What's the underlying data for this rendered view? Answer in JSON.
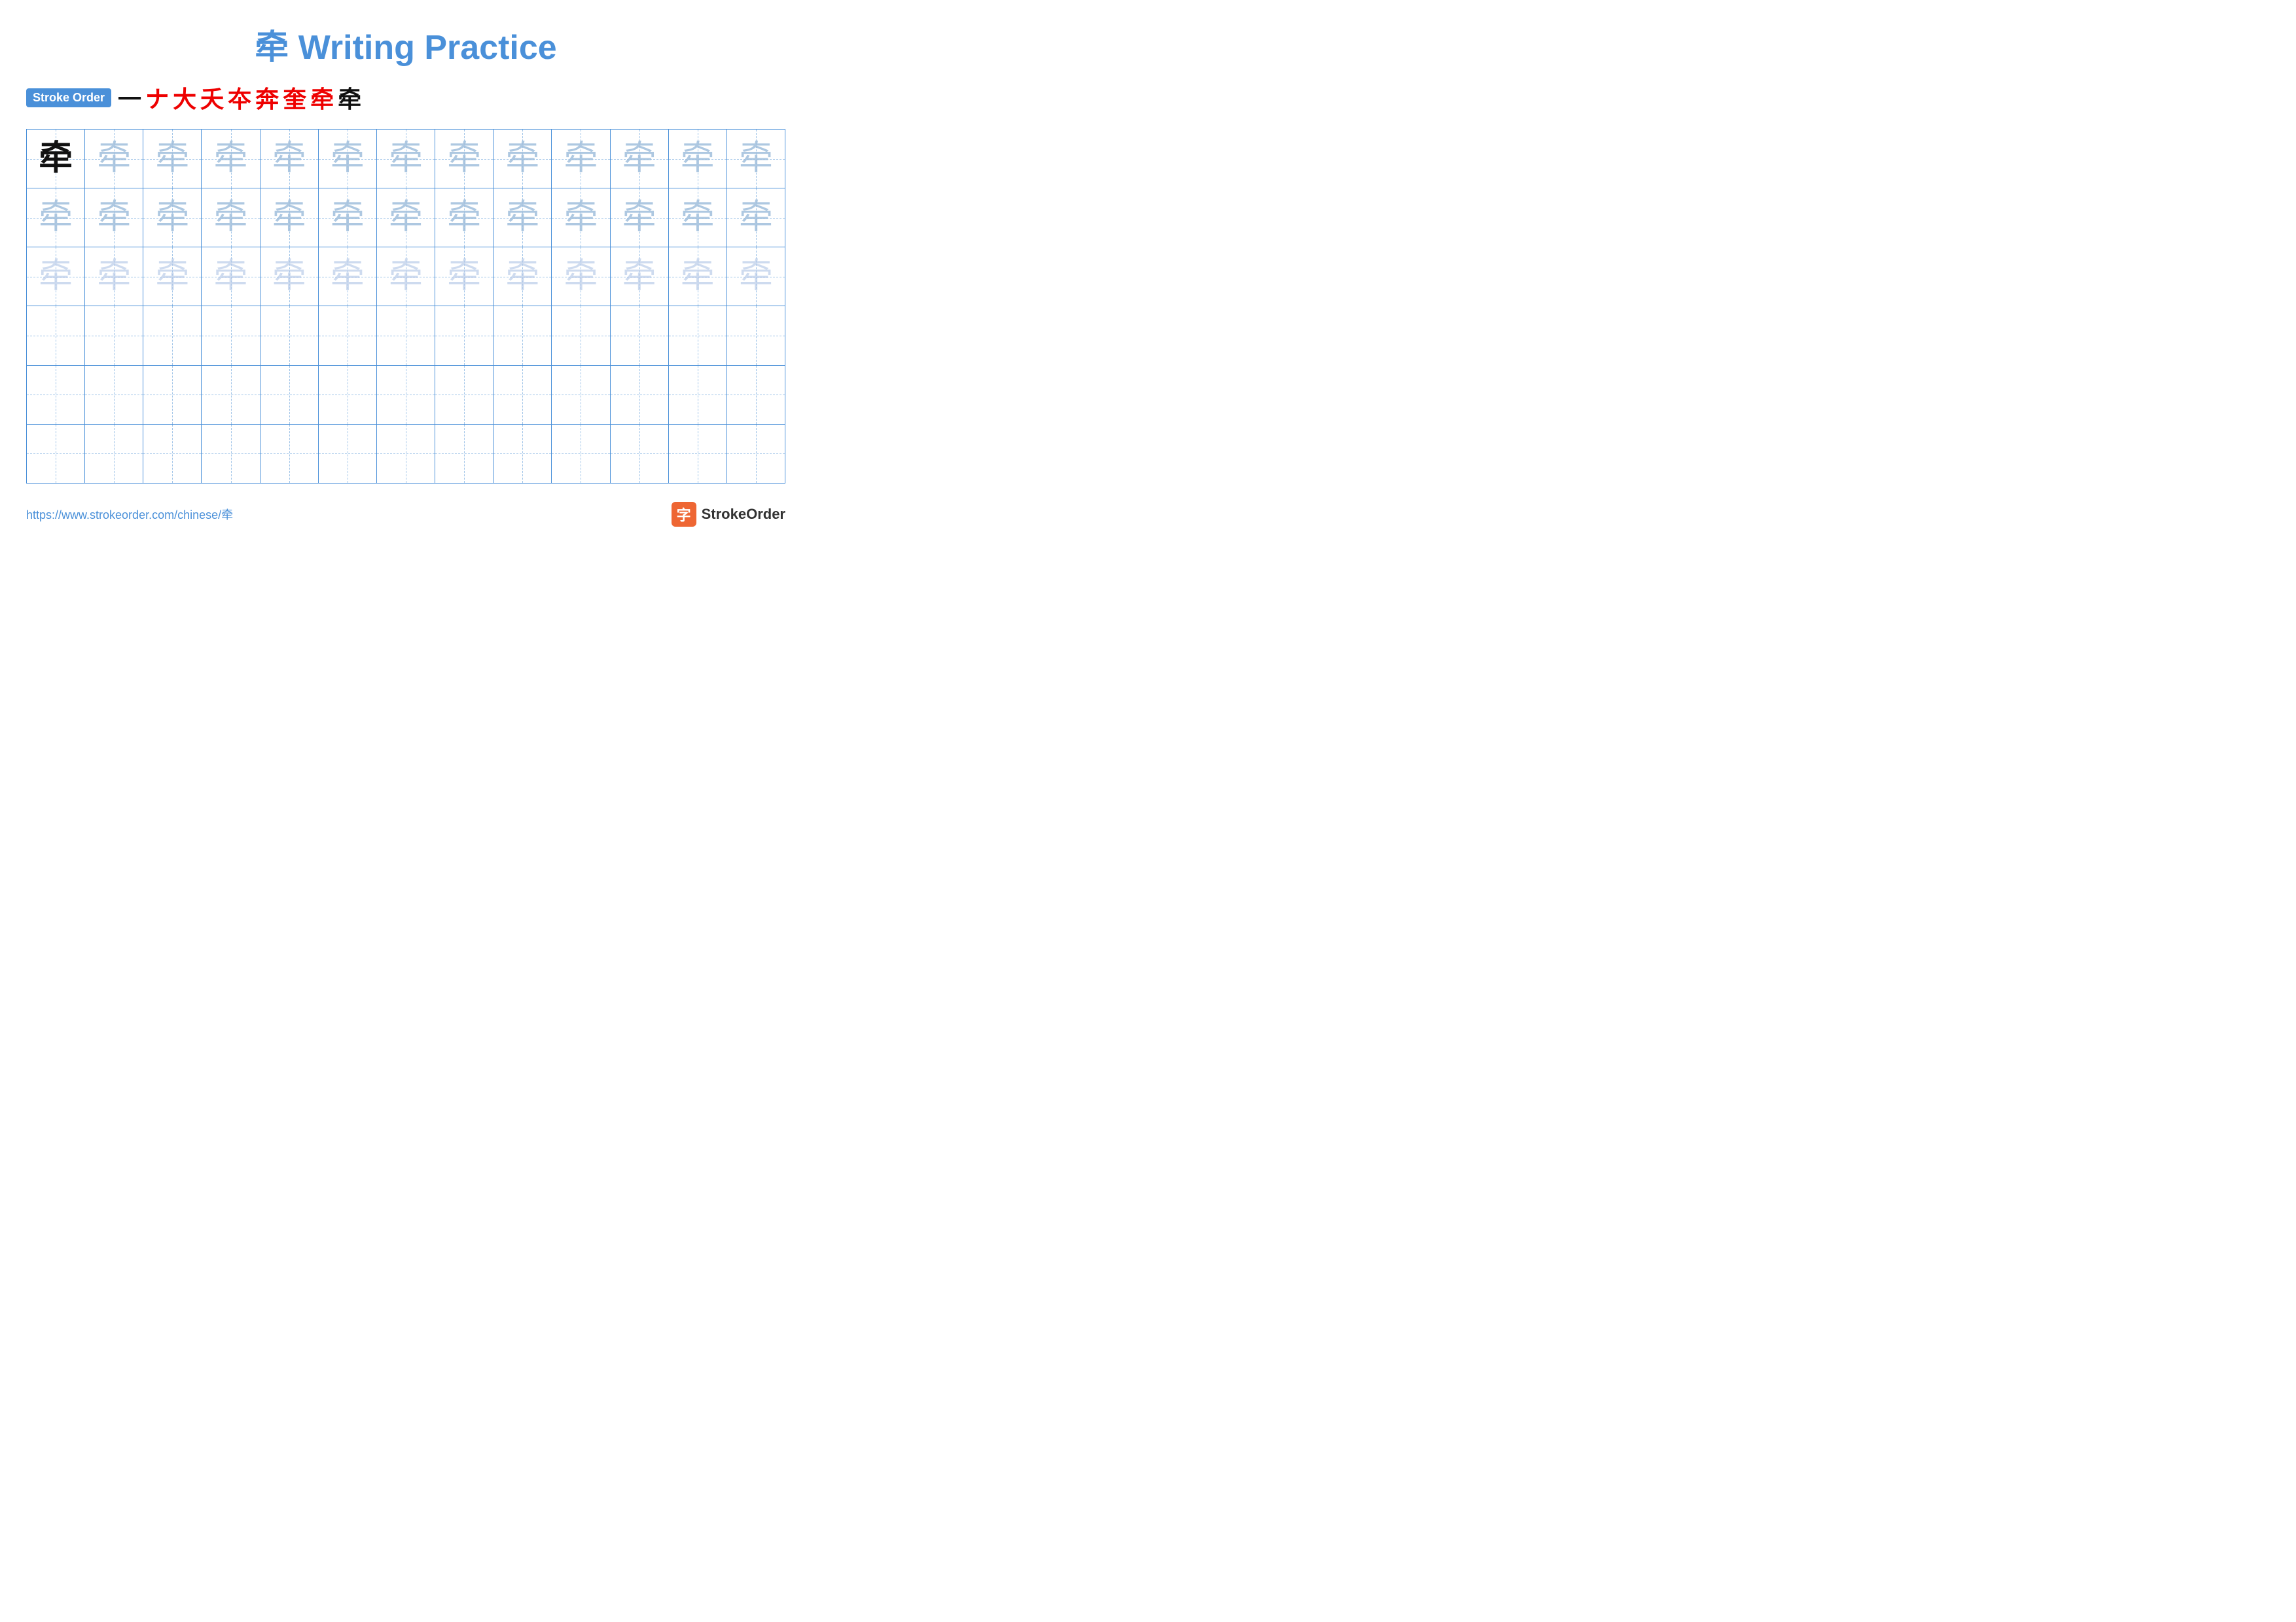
{
  "title": {
    "char": "牵",
    "text": "Writing Practice",
    "full": "牵 Writing Practice"
  },
  "stroke_order": {
    "badge_label": "Stroke Order",
    "chars": [
      "一",
      "ナ",
      "大",
      "夭",
      "夲",
      "奔",
      "奎",
      "牵",
      "牵"
    ]
  },
  "grid": {
    "cols": 13,
    "rows": 6,
    "char": "牵",
    "row_descriptions": [
      "solid+light1x12",
      "light1x13",
      "light2x13",
      "empty",
      "empty",
      "empty"
    ]
  },
  "footer": {
    "url": "https://www.strokeorder.com/chinese/牵",
    "logo_char": "字",
    "logo_text": "StrokeOrder"
  }
}
